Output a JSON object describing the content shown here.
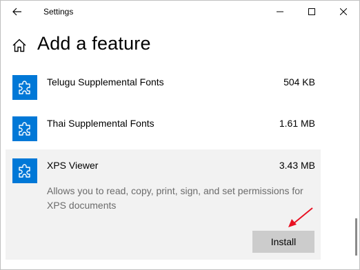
{
  "window": {
    "title": "Settings",
    "caption_buttons": {
      "minimize": "minimize",
      "maximize": "maximize",
      "close": "close"
    }
  },
  "page": {
    "title": "Add a feature"
  },
  "features": [
    {
      "name": "Telugu Supplemental Fonts",
      "size": "504 KB",
      "icon": "puzzle-piece-icon"
    },
    {
      "name": "Thai Supplemental Fonts",
      "size": "1.61 MB",
      "icon": "puzzle-piece-icon"
    },
    {
      "name": "XPS Viewer",
      "size": "3.43 MB",
      "icon": "puzzle-piece-icon",
      "description": "Allows you to read, copy, print, sign, and set permissions for XPS documents",
      "expanded": true,
      "action_label": "Install"
    }
  ],
  "colors": {
    "accent": "#0078d7",
    "selected_background": "#f2f2f2",
    "button_background": "#cccccc",
    "annotation_arrow": "#e81123"
  }
}
